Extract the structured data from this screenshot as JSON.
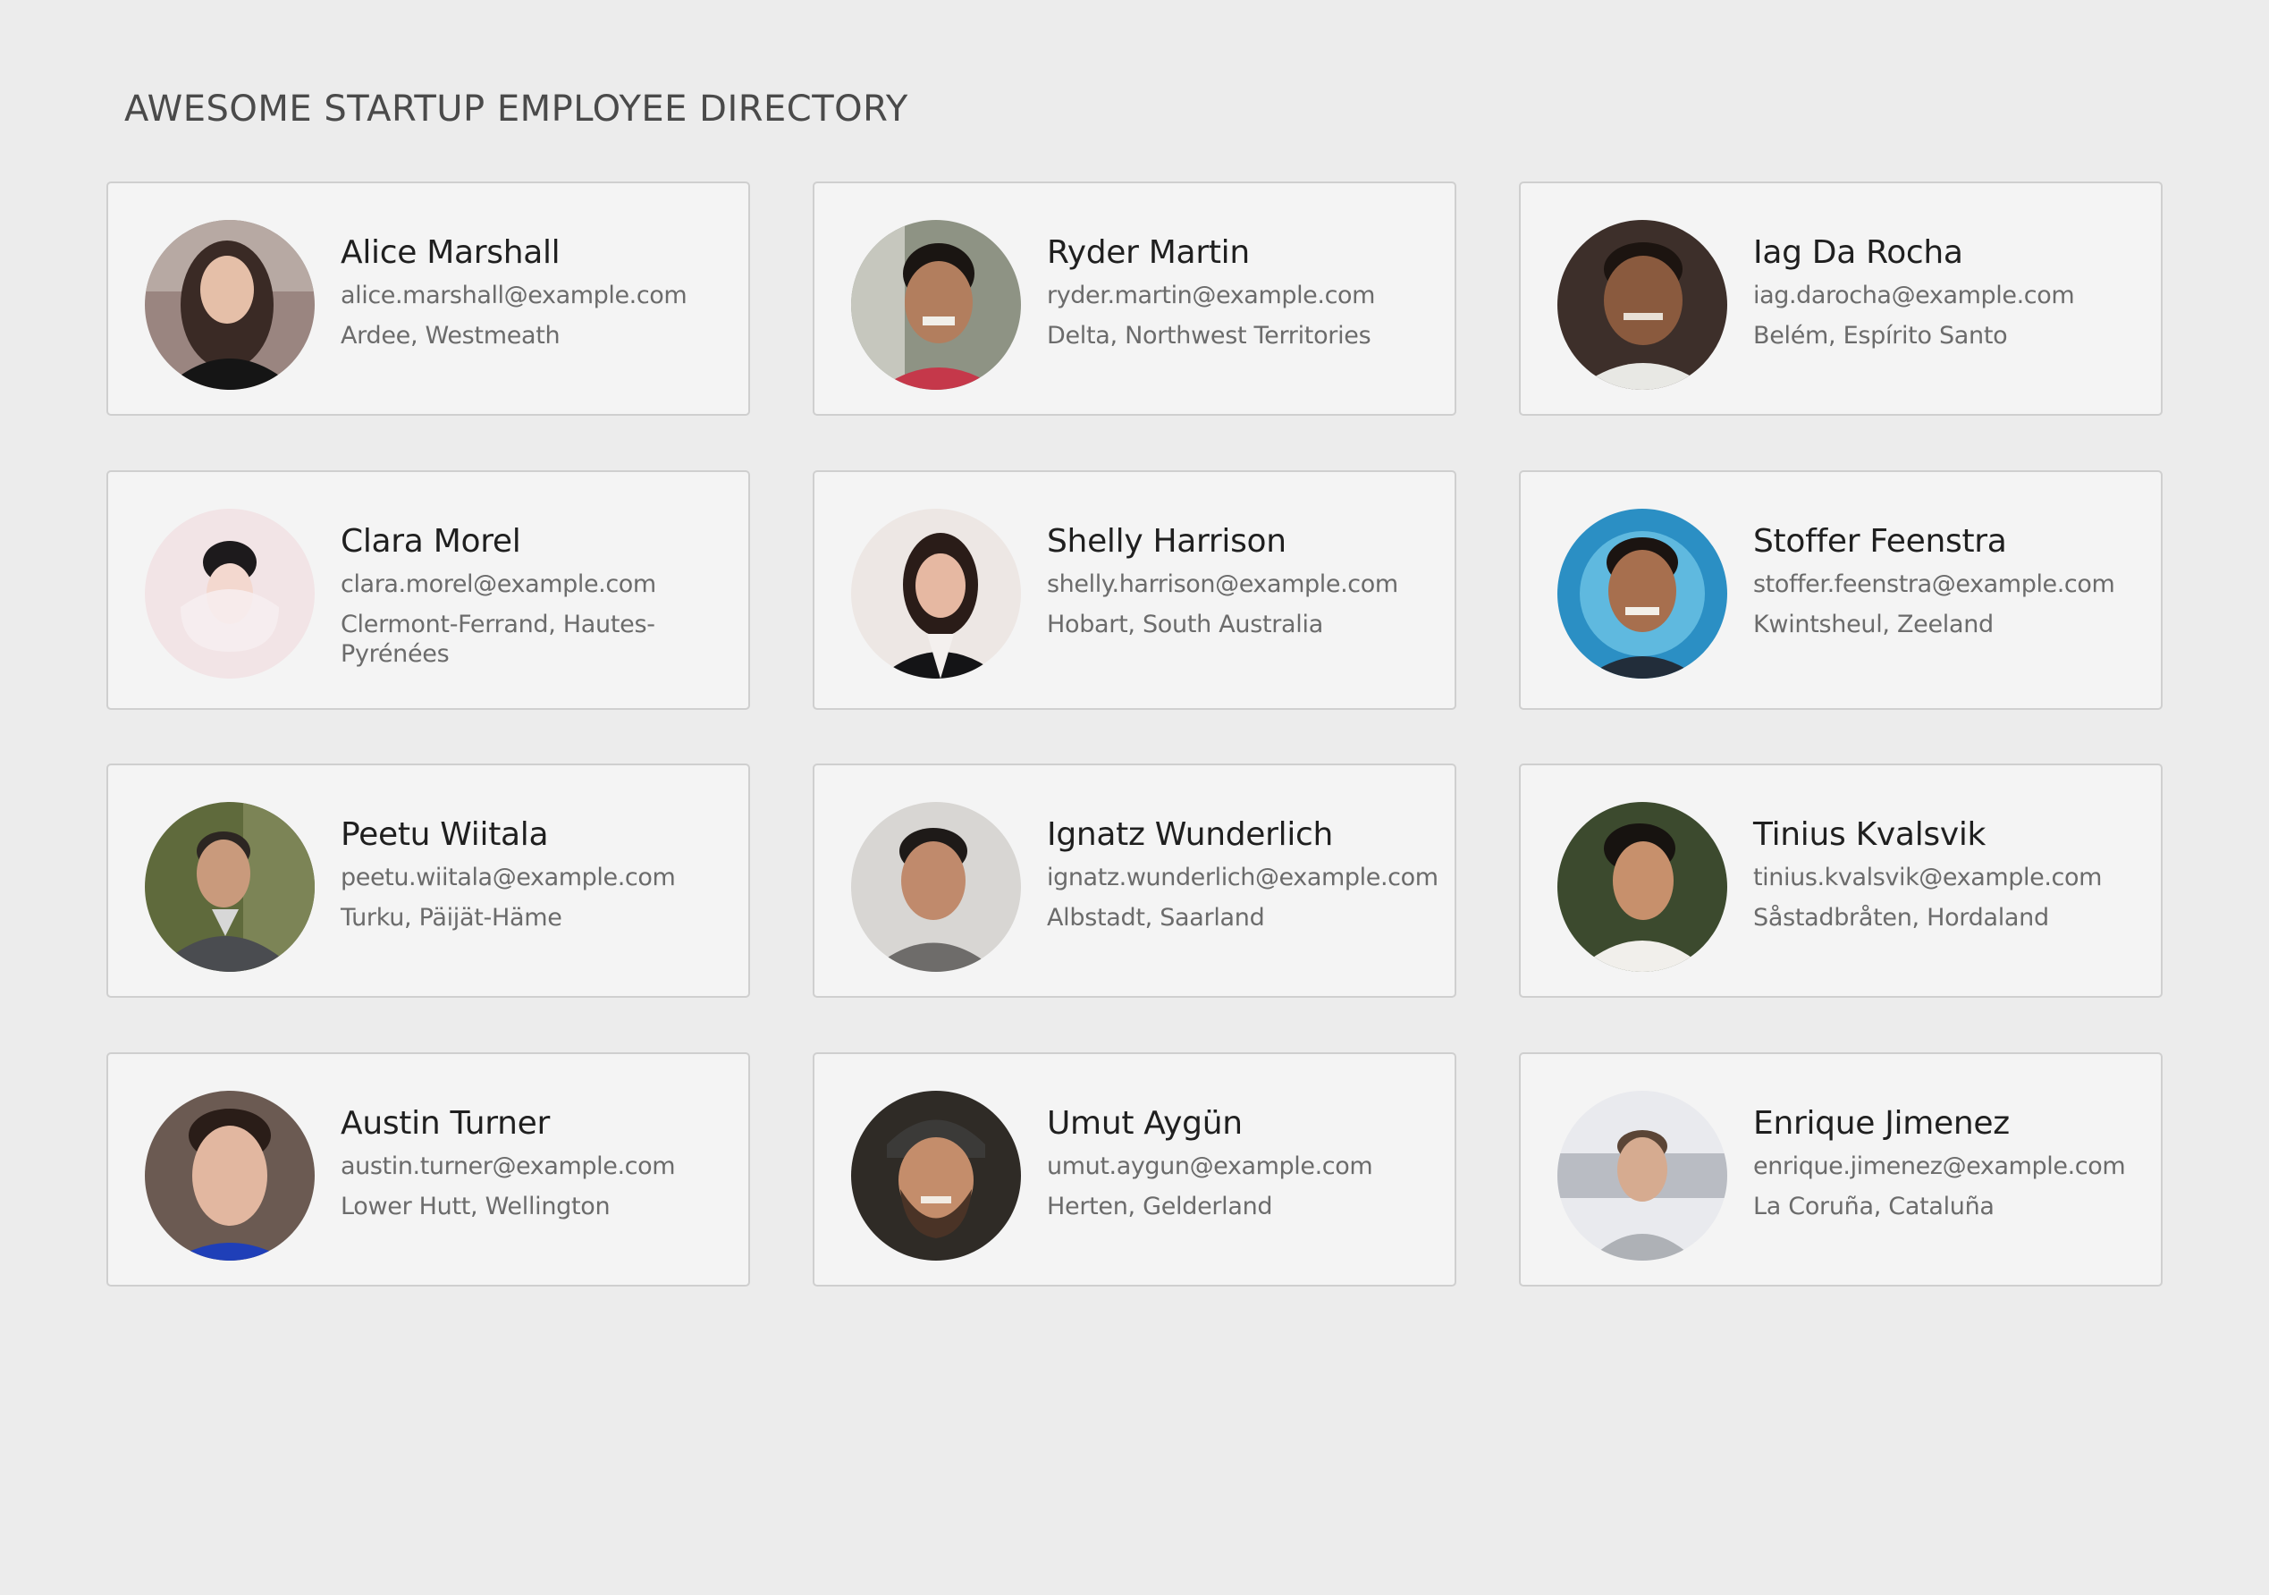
{
  "header": {
    "title": "AWESOME STARTUP EMPLOYEE DIRECTORY"
  },
  "colors": {
    "background": "#ececec",
    "card": "#f4f4f4",
    "card_border": "#cfcfcf",
    "name_text": "#1f1f1f",
    "secondary_text": "#6b6b6b"
  },
  "employees": [
    {
      "name": "Alice Marshall",
      "email": "alice.marshall@example.com",
      "location": "Ardee, Westmeath",
      "avatar_icon": "person-photo"
    },
    {
      "name": "Ryder Martin",
      "email": "ryder.martin@example.com",
      "location": "Delta, Northwest Territories",
      "avatar_icon": "person-photo"
    },
    {
      "name": "Iag Da Rocha",
      "email": "iag.darocha@example.com",
      "location": "Belém, Espírito Santo",
      "avatar_icon": "person-photo"
    },
    {
      "name": "Clara Morel",
      "email": "clara.morel@example.com",
      "location": "Clermont-Ferrand, Hautes-Pyrénées",
      "avatar_icon": "person-photo"
    },
    {
      "name": "Shelly Harrison",
      "email": "shelly.harrison@example.com",
      "location": "Hobart, South Australia",
      "avatar_icon": "person-photo"
    },
    {
      "name": "Stoffer Feenstra",
      "email": "stoffer.feenstra@example.com",
      "location": "Kwintsheul, Zeeland",
      "avatar_icon": "person-photo"
    },
    {
      "name": "Peetu Wiitala",
      "email": "peetu.wiitala@example.com",
      "location": "Turku, Päijät-Häme",
      "avatar_icon": "person-photo"
    },
    {
      "name": "Ignatz Wunderlich",
      "email": "ignatz.wunderlich@example.com",
      "location": "Albstadt, Saarland",
      "avatar_icon": "person-photo"
    },
    {
      "name": "Tinius Kvalsvik",
      "email": "tinius.kvalsvik@example.com",
      "location": "Såstadbråten, Hordaland",
      "avatar_icon": "person-photo"
    },
    {
      "name": "Austin Turner",
      "email": "austin.turner@example.com",
      "location": "Lower Hutt, Wellington",
      "avatar_icon": "person-photo"
    },
    {
      "name": "Umut Aygün",
      "email": "umut.aygun@example.com",
      "location": "Herten, Gelderland",
      "avatar_icon": "person-photo"
    },
    {
      "name": "Enrique Jimenez",
      "email": "enrique.jimenez@example.com",
      "location": "La Coruña, Cataluña",
      "avatar_icon": "person-photo"
    }
  ]
}
